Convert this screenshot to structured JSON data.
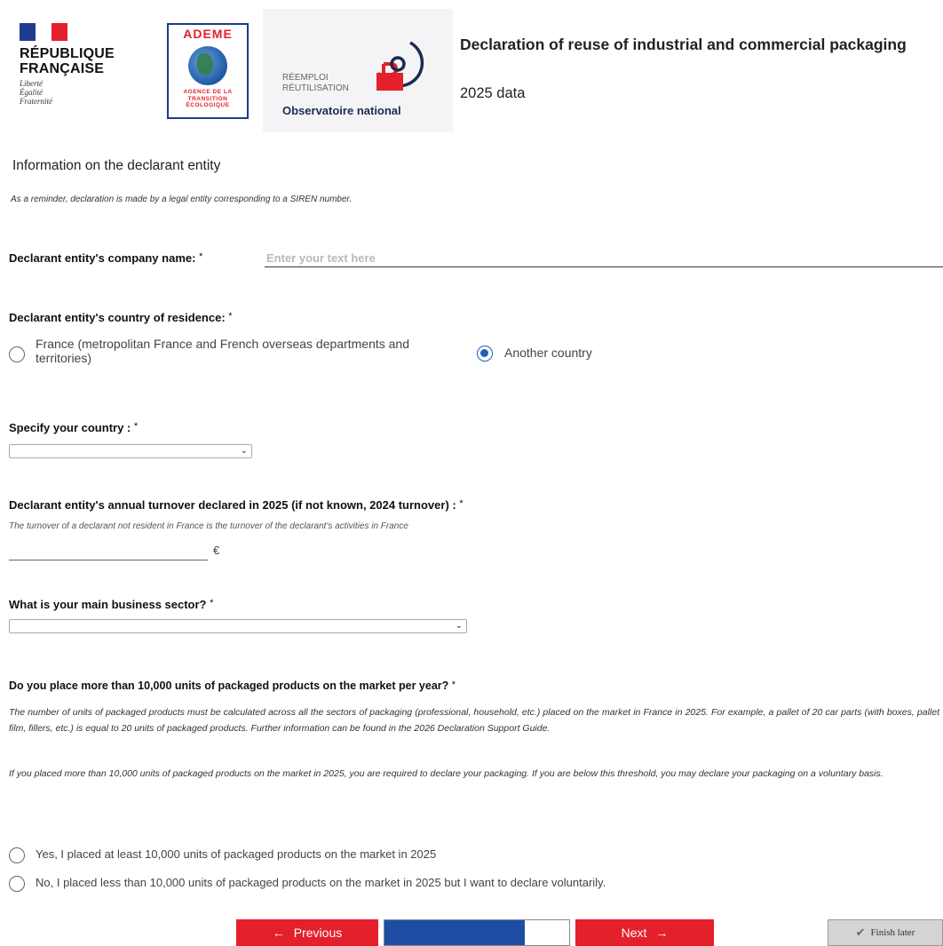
{
  "header": {
    "gov_name_line1": "RÉPUBLIQUE",
    "gov_name_line2": "FRANÇAISE",
    "gov_motto_1": "Liberté",
    "gov_motto_2": "Égalité",
    "gov_motto_3": "Fraternité",
    "ademe_title": "ADEME",
    "ademe_sub_1": "AGENCE DE LA",
    "ademe_sub_2": "TRANSITION",
    "ademe_sub_3": "ÉCOLOGIQUE",
    "obs_small_1": "RÉEMPLOI",
    "obs_small_2": "RÉUTILISATION",
    "obs_name": "Observatoire national",
    "title": "Declaration of reuse of industrial and commercial packaging",
    "subtitle": "2025 data"
  },
  "section": {
    "heading": "Information on the declarant entity",
    "reminder": "As a reminder, declaration is made by a legal entity corresponding to a SIREN number."
  },
  "company_name": {
    "label": "Declarant entity's company name:",
    "required": "*",
    "placeholder": "Enter your text here",
    "value": ""
  },
  "country_residence": {
    "label": "Declarant entity's country of residence:",
    "required": "*",
    "option_france": "France (metropolitan France and French overseas departments and territories)",
    "option_other": "Another country",
    "selected": "Another country"
  },
  "specify_country": {
    "label": "Specify your country :",
    "required": "*",
    "selected": ""
  },
  "turnover": {
    "label": "Declarant entity's annual turnover declared in 2025 (if not known, 2024 turnover) :",
    "required": "*",
    "note": "The turnover of a declarant not resident in France is the turnover of the declarant's activities in France",
    "value": "",
    "unit": "€"
  },
  "sector": {
    "label": "What is your main business sector?",
    "required": "*",
    "selected": ""
  },
  "units": {
    "label": "Do you place more than 10,000 units of packaged products on the market per year?",
    "required": "*",
    "para1": "The number of units of packaged products must be calculated across all the sectors of packaging (professional, household, etc.) placed on the market in France in 2025. For example, a pallet of 20 car parts (with boxes, pallet film, fillers, etc.) is equal to 20 units of packaged products. Further information can be found in the 2026 Declaration Support Guide.",
    "para2": "If you placed more than 10,000 units of packaged products on the market in 2025, you are required to declare your packaging. If you are below this threshold, you may declare your packaging on a voluntary basis.",
    "option_yes": "Yes, I placed at least 10,000 units of packaged products on the market in 2025",
    "option_no": "No, I placed less than 10,000 units of packaged products on the market in 2025 but I want to declare voluntarily."
  },
  "nav": {
    "previous_label": "Previous",
    "next_label": "Next",
    "finish_later_label": "Finish later",
    "progress_fraction": 0.76
  },
  "colors": {
    "red": "#e3202b",
    "blue": "#1e4ea3",
    "radio_blue": "#1f5fbf"
  }
}
